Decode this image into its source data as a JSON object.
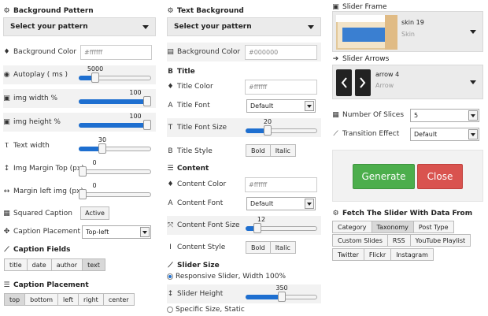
{
  "col1": {
    "bg_pattern_title": "Background Pattern",
    "select_pattern": "Select your pattern",
    "bg_color_label": "Background Color",
    "bg_color_value": "#ffffff",
    "autoplay_label": "Autoplay ( ms )",
    "autoplay_value": "5000",
    "img_width_label": "img width %",
    "img_width_value": "100",
    "img_height_label": "img height %",
    "img_height_value": "100",
    "text_width_label": "Text width",
    "text_width_value": "30",
    "img_margin_top_label": "Img Margin Top (px)",
    "img_margin_top_value": "0",
    "margin_left_label": "Margin left img (px)",
    "margin_left_value": "0",
    "squared_caption_label": "Squared Caption",
    "squared_caption_btn": "Active",
    "caption_placement_label": "Caption Placement",
    "caption_placement_value": "Top-left",
    "caption_fields_title": "Caption Fields",
    "caption_fields": [
      "title",
      "date",
      "author",
      "text"
    ],
    "caption_placement_title": "Caption Placement",
    "placements": [
      "top",
      "bottom",
      "left",
      "right",
      "center"
    ]
  },
  "col2": {
    "text_bg_title": "Text Background",
    "select_pattern": "Select your pattern",
    "bg_color_label": "Background Color",
    "bg_color_value": "#000000",
    "title_section": "Title",
    "title_color_label": "Title Color",
    "title_color_value": "#ffffff",
    "title_font_label": "Title Font",
    "title_font_value": "Default",
    "title_font_size_label": "Title Font Size",
    "title_font_size_value": "20",
    "title_style_label": "Title Style",
    "bold": "Bold",
    "italic": "Italic",
    "content_section": "Content",
    "content_color_label": "Content Color",
    "content_color_value": "#ffffff",
    "content_font_label": "Content Font",
    "content_font_value": "Default",
    "content_font_size_label": "Content Font Size",
    "content_font_size_value": "12",
    "content_style_label": "Content Style",
    "slider_size_title": "Slider Size",
    "responsive_label": "Responsive Slider, Width 100%",
    "slider_height_label": "Slider Height",
    "slider_height_value": "350",
    "specific_label": "Specific Size, Static"
  },
  "col3": {
    "slider_frame_title": "Slider Frame",
    "frame_name": "skin 19",
    "frame_sub": "Skin",
    "slider_arrows_title": "Slider Arrows",
    "arrow_name": "arrow 4",
    "arrow_sub": "Arrow",
    "slices_label": "Number Of Slices",
    "slices_value": "5",
    "transition_label": "Transition Effect",
    "transition_value": "Default",
    "generate": "Generate",
    "close": "Close",
    "fetch_title": "Fetch The Slider With Data From",
    "sources_row1": [
      "Category",
      "Taxonomy",
      "Post Type"
    ],
    "sources_row2": [
      "Custom Slides",
      "RSS",
      "YouTube Playlist"
    ],
    "sources_row3": [
      "Twitter",
      "Flickr",
      "Instagram"
    ]
  },
  "levels": {
    "autoplay": 0.2,
    "img_width": 1.0,
    "img_height": 1.0,
    "text_width": 0.3,
    "img_margin_top": 0.0,
    "margin_left": 0.0,
    "title_font_size": 0.28,
    "content_font_size": 0.12,
    "slider_height": 0.5
  },
  "colors": {
    "accent": "#1e6fd0",
    "generate": "#4cae4c",
    "close": "#d9534f"
  }
}
